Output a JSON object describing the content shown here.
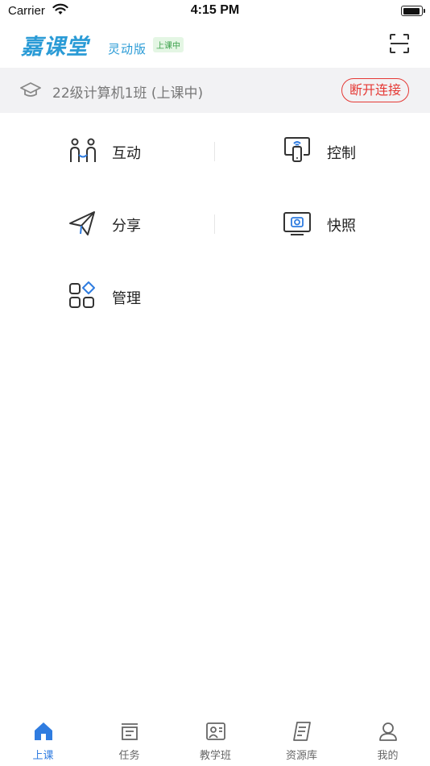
{
  "status_bar": {
    "carrier": "Carrier",
    "time": "4:15 PM",
    "battery_level": 0.95
  },
  "header": {
    "logo_text": "嘉课堂",
    "edition": "灵动版",
    "badge": "上课中",
    "scan_icon": "scan-icon",
    "brand_color": "#2a9bd6"
  },
  "class_bar": {
    "icon": "graduation-cap-icon",
    "class_name": "22级计算机1班 (上课中)",
    "disconnect_label": "断开连接",
    "accent_color": "#e53935"
  },
  "features": [
    {
      "label": "互动",
      "icon": "interaction-icon"
    },
    {
      "label": "控制",
      "icon": "remote-control-icon"
    },
    {
      "label": "分享",
      "icon": "share-plane-icon"
    },
    {
      "label": "快照",
      "icon": "snapshot-icon"
    },
    {
      "label": "管理",
      "icon": "manage-grid-icon"
    }
  ],
  "tab_bar": {
    "active_color": "#2f7ce0",
    "tabs": [
      {
        "label": "上课",
        "icon": "home-icon",
        "active": true
      },
      {
        "label": "任务",
        "icon": "task-icon",
        "active": false
      },
      {
        "label": "教学班",
        "icon": "class-icon",
        "active": false
      },
      {
        "label": "资源库",
        "icon": "resource-icon",
        "active": false
      },
      {
        "label": "我的",
        "icon": "profile-icon",
        "active": false
      }
    ]
  }
}
